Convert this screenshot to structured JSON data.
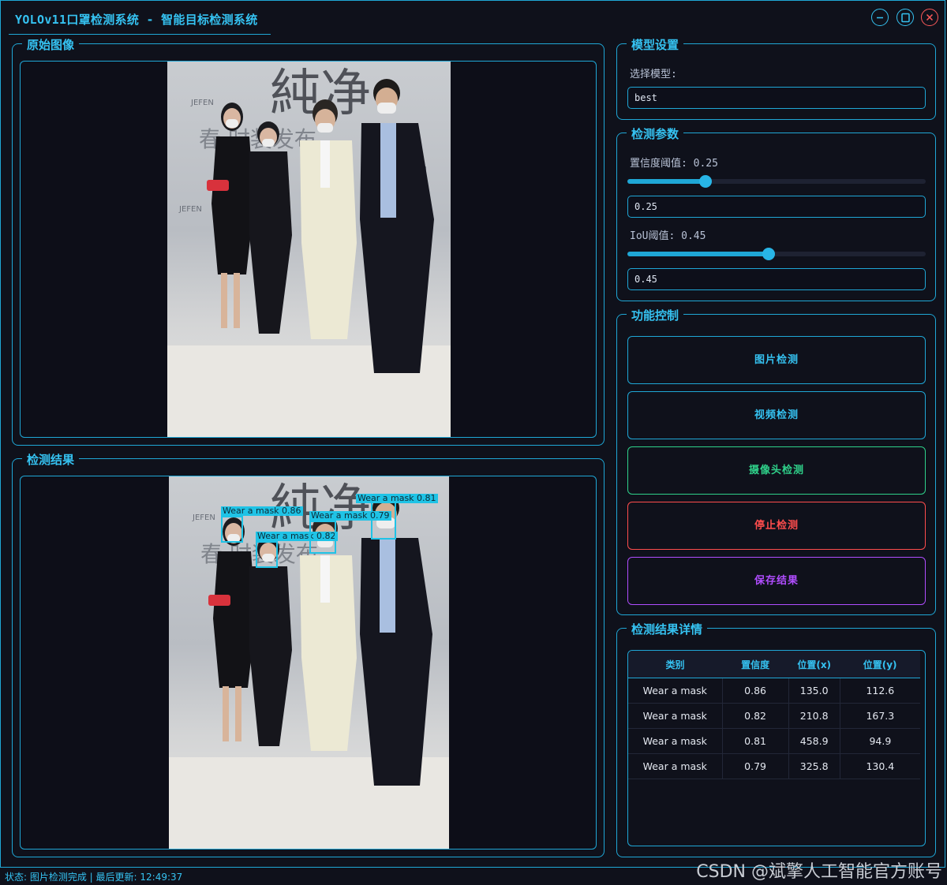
{
  "window": {
    "title": "YOLOv11口罩检测系统 - 智能目标检测系统"
  },
  "panels": {
    "original": {
      "title": "原始图像"
    },
    "result": {
      "title": "检测结果"
    },
    "model": {
      "title": "模型设置",
      "select_label": "选择模型:",
      "selected_model": "best"
    },
    "params": {
      "title": "检测参数",
      "conf_label": "置信度阈值: 0.25",
      "conf_value": "0.25",
      "conf_level": 0.25,
      "iou_label": "IoU阈值: 0.45",
      "iou_value": "0.45",
      "iou_level": 0.45
    },
    "controls": {
      "title": "功能控制",
      "image_btn": "图片检测",
      "video_btn": "视频检测",
      "camera_btn": "摄像头检测",
      "stop_btn": "停止检测",
      "save_btn": "保存结果"
    },
    "details": {
      "title": "检测结果详情",
      "headers": [
        "类别",
        "置信度",
        "位置(x)",
        "位置(y)"
      ],
      "rows": [
        [
          "Wear a mask",
          "0.86",
          "135.0",
          "112.6"
        ],
        [
          "Wear a mask",
          "0.82",
          "210.8",
          "167.3"
        ],
        [
          "Wear a mask",
          "0.81",
          "458.9",
          "94.9"
        ],
        [
          "Wear a mask",
          "0.79",
          "325.8",
          "130.4"
        ]
      ]
    }
  },
  "photo": {
    "banner_text": "純净",
    "sub_text": "春·时装发布",
    "logo": "JEFEN"
  },
  "detections": [
    {
      "label": "Wear a mask 0.86"
    },
    {
      "label": "Wear a mask 0.82"
    },
    {
      "label": "Wear a mask 0.81"
    },
    {
      "label": "Wear a mask 0.79"
    }
  ],
  "status": {
    "text": "状态: 图片检测完成 | 最后更新: 12:49:37"
  },
  "watermark": "CSDN @斌擎人工智能官方账号",
  "colors": {
    "accent": "#1fa7d6",
    "title": "#35c2f1",
    "image_btn": "#1fa7d6",
    "video_btn": "#1fa7d6",
    "camera_btn": "#2fd18a",
    "stop_btn": "#ff4d4d",
    "save_btn": "#b04dff"
  },
  "icons": {
    "minimize": "minimize-icon",
    "maximize": "maximize-icon",
    "close": "close-icon"
  }
}
